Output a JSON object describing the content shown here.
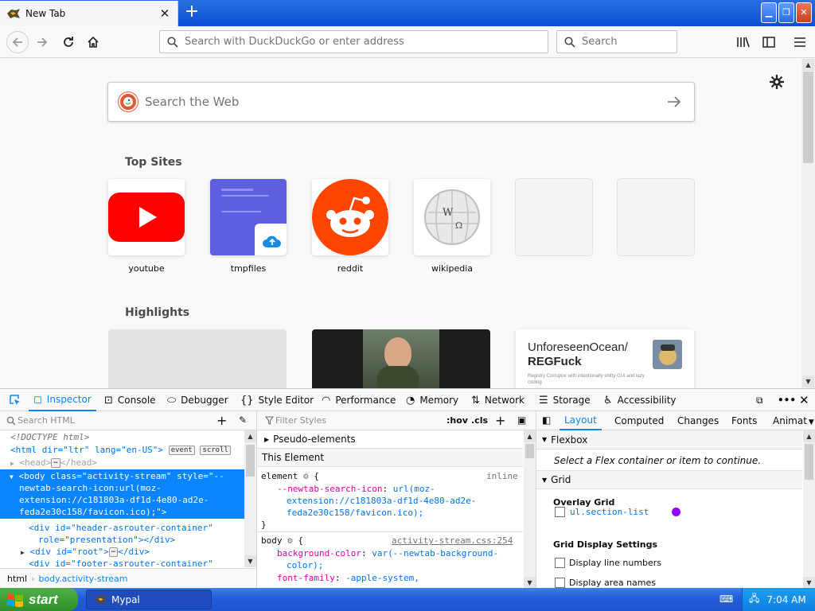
{
  "browser": {
    "tab_title": "New Tab",
    "urlbar_placeholder": "Search with DuckDuckGo or enter address",
    "searchbar_placeholder": "Search"
  },
  "newtab": {
    "web_search_placeholder": "Search the Web",
    "top_sites_title": "Top Sites",
    "top_sites": [
      {
        "label": "youtube"
      },
      {
        "label": "tmpfiles"
      },
      {
        "label": "reddit"
      },
      {
        "label": "wikipedia"
      },
      {
        "label": ""
      },
      {
        "label": ""
      }
    ],
    "highlights_title": "Highlights",
    "highlight_card": {
      "title_line1": "UnforeseenOcean/",
      "title_line2": "REGFuck",
      "desc": "Registry Corruptor with intentionally shitty GUI and lazy coding"
    }
  },
  "devtools": {
    "tabs": [
      "Inspector",
      "Console",
      "Debugger",
      "Style Editor",
      "Performance",
      "Memory",
      "Network",
      "Storage",
      "Accessibility"
    ],
    "search_html_placeholder": "Search HTML",
    "filter_styles_placeholder": "Filter Styles",
    "hov_label": ":hov",
    "cls_label": ".cls",
    "side_tabs": [
      "Layout",
      "Computed",
      "Changes",
      "Fonts",
      "Animat"
    ],
    "markup": {
      "doctype": "<!DOCTYPE html>",
      "html_tag": "<html dir=\"ltr\" lang=\"en-US\">",
      "html_badges": [
        "event",
        "scroll"
      ],
      "head": "<head>",
      "head_close": "</head>",
      "body_line1": "<body class=\"activity-stream\" style=\"--",
      "body_line2": "newtab-search-icon:url(moz-",
      "body_line3": "extension://c181803a-df1d-4e80-ad2e-",
      "body_line4": "feda2e30c158/favicon.ico);\">",
      "div1_line1": "<div id=\"header-asrouter-container\"",
      "div1_line2": "role=\"presentation\"></div>",
      "div2": "<div id=\"root\">",
      "div2_close": "</div>",
      "div3": "<div id=\"footer-asrouter-container\""
    },
    "breadcrumb": [
      "html",
      "body.activity-stream"
    ],
    "rules": {
      "pseudo": "Pseudo-elements",
      "this_element": "This Element",
      "element_selector": "element",
      "element_source": "inline",
      "prop1_name": "--newtab-search-icon",
      "prop1_val_l1": "url(moz-",
      "prop1_val_l2": "extension://c181803a-df1d-4e80-ad2e-",
      "prop1_val_l3": "feda2e30c158/favicon.ico);",
      "body_selector": "body",
      "body_source": "activity-stream.css:254",
      "bg_prop": "background-color",
      "bg_val_l1": "var(--newtab-background-",
      "bg_val_l2": "color);",
      "ff_prop": "font-family",
      "ff_val": "-apple-system,"
    },
    "layout": {
      "flexbox_header": "Flexbox",
      "flexbox_msg": "Select a Flex container or item to continue.",
      "grid_header": "Grid",
      "overlay_grid": "Overlay Grid",
      "grid_item": "ul.section-list",
      "grid_color": "#9400ff",
      "grid_display_settings": "Grid Display Settings",
      "display_line_numbers": "Display line numbers",
      "display_area_names": "Display area names"
    }
  },
  "taskbar": {
    "start_label": "start",
    "task_label": "Mypal",
    "clock": "7:04 AM"
  }
}
